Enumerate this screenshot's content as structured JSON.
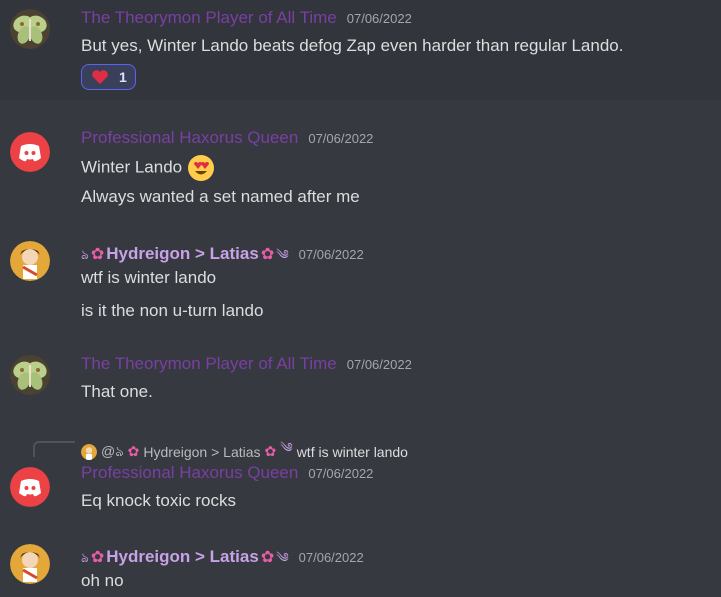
{
  "messages": {
    "m1": {
      "author": "The Theorymon Player of All Time",
      "timestamp": "07/06/2022",
      "lines": [
        "But yes, Winter Lando beats defog Zap even harder than regular Lando."
      ],
      "reaction": {
        "emoji": "heart-icon",
        "count": "1"
      }
    },
    "m2": {
      "author": "Professional Haxorus Queen",
      "timestamp": "07/06/2022",
      "lines": [
        "Winter Lando",
        "Always wanted a set named after me"
      ]
    },
    "m3": {
      "author_prefix": "ঌ",
      "author": "Hydreigon > Latias",
      "author_suffix": "༄",
      "timestamp": "07/06/2022",
      "lines": [
        "wtf is winter lando",
        "is it the non u-turn lando"
      ]
    },
    "m4": {
      "author": "The Theorymon Player of All Time",
      "timestamp": "07/06/2022",
      "lines": [
        "That one."
      ]
    },
    "m5": {
      "reply_to": {
        "author": "@ঌ",
        "author_name": "Hydreigon > Latias",
        "snippet": "wtf is winter lando"
      },
      "author": "Professional Haxorus Queen",
      "timestamp": "07/06/2022",
      "lines": [
        "Eq knock toxic rocks"
      ]
    },
    "m6": {
      "author_prefix": "ঌ",
      "author": "Hydreigon > Latias",
      "author_suffix": "༄",
      "timestamp": "07/06/2022",
      "lines": [
        "oh no"
      ]
    }
  },
  "colors": {
    "background": "#36393f",
    "theorymon_name": "#7a3fa3",
    "hydreigon_name": "#c8a2e6",
    "discord_red": "#ed4245",
    "reaction_border": "#5865f2"
  }
}
